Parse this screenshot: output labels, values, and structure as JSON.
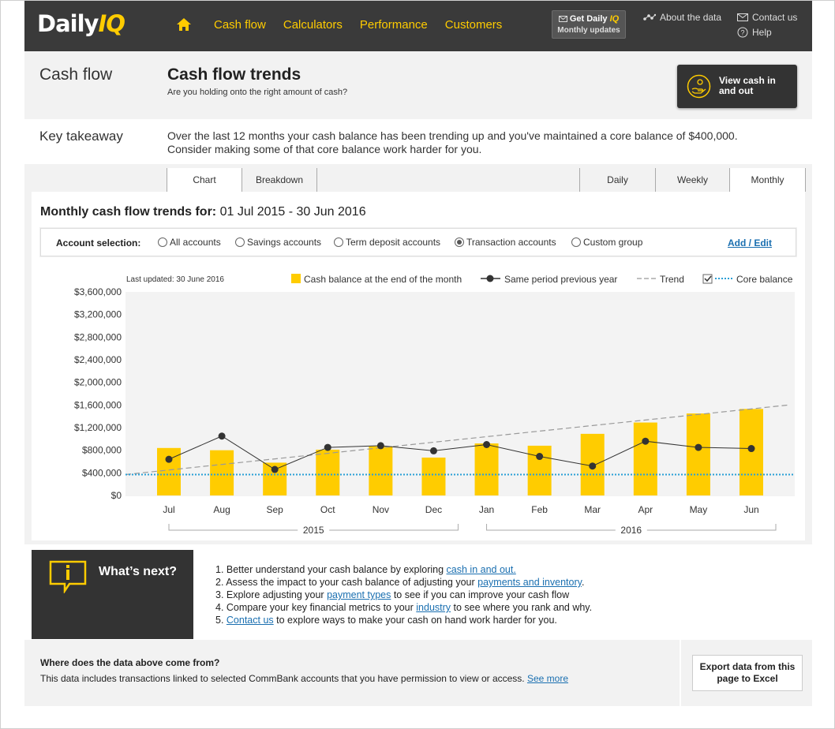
{
  "header": {
    "logo_main": "Daily",
    "logo_accent": "IQ",
    "nav": [
      "Cash flow",
      "Calculators",
      "Performance",
      "Customers"
    ],
    "promo_line1_a": "Get Daily ",
    "promo_line1_b": "IQ",
    "promo_line2": "Monthly updates",
    "about": "About the data",
    "contact": "Contact us",
    "help": "Help"
  },
  "title": {
    "section": "Cash flow",
    "heading": "Cash flow trends",
    "subtitle": "Are you holding onto the right amount of cash?",
    "cash_button": "View cash in and out"
  },
  "takeaway": {
    "label": "Key takeaway",
    "text": "Over the last 12 months your cash balance has been trending up and you've maintained a core balance of $400,000. Consider making some of that core balance work harder for you."
  },
  "tabs": {
    "left": [
      "Chart",
      "Breakdown"
    ],
    "right": [
      "Daily",
      "Weekly",
      "Monthly"
    ]
  },
  "chart_heading": {
    "prefix": "Monthly cash flow trends for:",
    "range": " 01 Jul 2015 - 30 Jun 2016"
  },
  "accounts": {
    "label": "Account selection:",
    "options": [
      "All accounts",
      "Savings accounts",
      "Term deposit accounts",
      "Transaction accounts",
      "Custom group"
    ],
    "selected": "Transaction accounts",
    "add_edit": "Add / Edit"
  },
  "colors": {
    "accent": "#ffcc00",
    "dark": "#333333",
    "link": "#1a6fb0",
    "core": "#2a9fd6"
  },
  "chart_data": {
    "type": "bar",
    "last_updated": "Last updated: 30 June 2016",
    "categories": [
      "Jul",
      "Aug",
      "Sep",
      "Oct",
      "Nov",
      "Dec",
      "Jan",
      "Feb",
      "Mar",
      "Apr",
      "May",
      "Jun"
    ],
    "year_groups": [
      {
        "label": "2015",
        "from": 0,
        "to": 5
      },
      {
        "label": "2016",
        "from": 6,
        "to": 11
      }
    ],
    "y_ticks": [
      "$0",
      "$400,000",
      "$800,000",
      "$1,200,000",
      "$1,600,000",
      "$2,000,000",
      "$2,400,000",
      "$2,800,000",
      "$3,200,000",
      "$3,600,000"
    ],
    "ylim": [
      0,
      3600000
    ],
    "grid": false,
    "legend_placement": "top",
    "series": [
      {
        "name": "Cash balance at the end of the month",
        "kind": "bar",
        "color": "#ffcc00",
        "values": [
          840000,
          800000,
          580000,
          810000,
          870000,
          670000,
          920000,
          880000,
          1090000,
          1290000,
          1450000,
          1530000
        ]
      },
      {
        "name": "Same period previous year",
        "kind": "line",
        "color": "#333333",
        "values": [
          640000,
          1050000,
          460000,
          850000,
          880000,
          790000,
          900000,
          690000,
          520000,
          960000,
          850000,
          830000
        ]
      },
      {
        "name": "Trend",
        "kind": "trend",
        "color": "#999999",
        "start": 370000,
        "end": 1600000
      },
      {
        "name": "Core balance",
        "kind": "reference",
        "color": "#2a9fd6",
        "value": 370000,
        "checked": true
      }
    ]
  },
  "whats_next": {
    "title": "What’s next?",
    "items": [
      {
        "pre": "1. Better understand your cash balance by exploring ",
        "link": "cash in and out.",
        "post": ""
      },
      {
        "pre": "2. Assess the impact to your cash balance of adjusting your ",
        "link": "payments and inventory",
        "post": "."
      },
      {
        "pre": "3. Explore adjusting your ",
        "link": "payment types",
        "post": " to see if you can improve your cash flow"
      },
      {
        "pre": "4. Compare your key financial metrics to your ",
        "link": "industry",
        "post": " to see where you rank and why."
      },
      {
        "pre": "5. ",
        "link": "Contact us",
        "post": " to explore ways to make your cash on hand work harder for you."
      }
    ]
  },
  "footer": {
    "question": "Where does the data above come from?",
    "text": "This data includes transactions linked to selected CommBank accounts that you have permission to view or access. ",
    "see_more": "See more",
    "export": "Export data from this page to Excel"
  }
}
